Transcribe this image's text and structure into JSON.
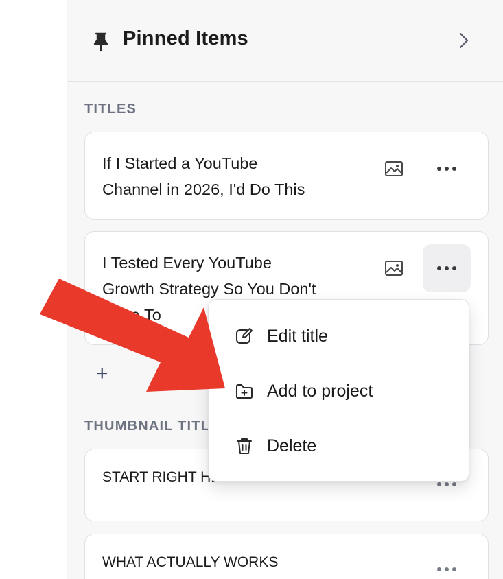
{
  "panel": {
    "title": "Pinned Items",
    "pin_icon": "pin-icon",
    "expand_icon": "chevron-right-icon"
  },
  "titles_section": {
    "label": "TITLES",
    "items": [
      {
        "line1": "If I Started a YouTube",
        "line2": "Channel in 2026, I'd Do This",
        "line3": ""
      },
      {
        "line1": "I Tested Every YouTube",
        "line2": "Growth Strategy So You Don't",
        "line3": "Have To"
      }
    ],
    "add_label": "+"
  },
  "thumbnail_section": {
    "label": "THUMBNAIL TITLES",
    "items": [
      {
        "text": "START RIGHT HERE"
      },
      {
        "text": "WHAT ACTUALLY WORKS"
      }
    ]
  },
  "context_menu": {
    "items": [
      {
        "label": "Edit title",
        "icon": "edit-icon"
      },
      {
        "label": "Add to project",
        "icon": "folder-plus-icon"
      },
      {
        "label": "Delete",
        "icon": "trash-icon"
      }
    ]
  },
  "colors": {
    "arrow": "#e8392b",
    "section_label": "#6e7382",
    "panel_bg": "#f7f7f8"
  }
}
